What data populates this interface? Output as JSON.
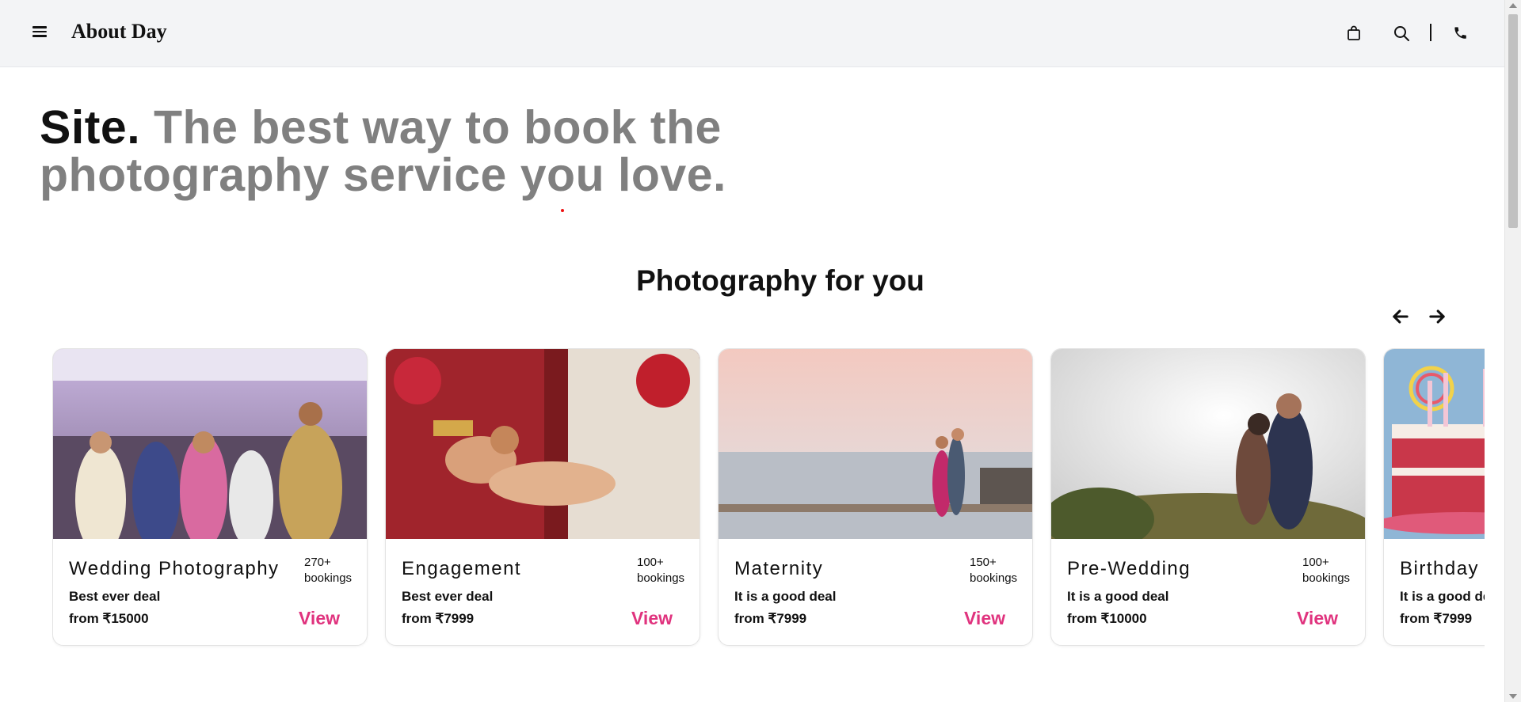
{
  "header": {
    "brand": "About Day",
    "icons": [
      "menu-icon",
      "bag-icon",
      "search-icon",
      "phone-icon"
    ]
  },
  "hero": {
    "strong": "Site.",
    "rest": "The best way to book the photography service you love."
  },
  "section": {
    "title": "Photography for you"
  },
  "colors": {
    "accent": "#e0337e",
    "muted_text": "#808080",
    "header_bg": "#f3f4f6"
  },
  "cards": [
    {
      "title": "Wedding Photography",
      "bookings_count": "270+",
      "bookings_label": "bookings",
      "deal": "Best ever deal",
      "price": "from ₹15000",
      "view": "View"
    },
    {
      "title": "Engagement",
      "bookings_count": "100+",
      "bookings_label": "bookings",
      "deal": "Best ever deal",
      "price": "from ₹7999",
      "view": "View"
    },
    {
      "title": "Maternity",
      "bookings_count": "150+",
      "bookings_label": "bookings",
      "deal": "It is a good deal",
      "price": "from ₹7999",
      "view": "View"
    },
    {
      "title": "Pre-Wedding",
      "bookings_count": "100+",
      "bookings_label": "bookings",
      "deal": "It is a good deal",
      "price": "from ₹10000",
      "view": "View"
    },
    {
      "title": "Birthday",
      "deal": "It is a good deal",
      "price": "from ₹7999"
    }
  ]
}
